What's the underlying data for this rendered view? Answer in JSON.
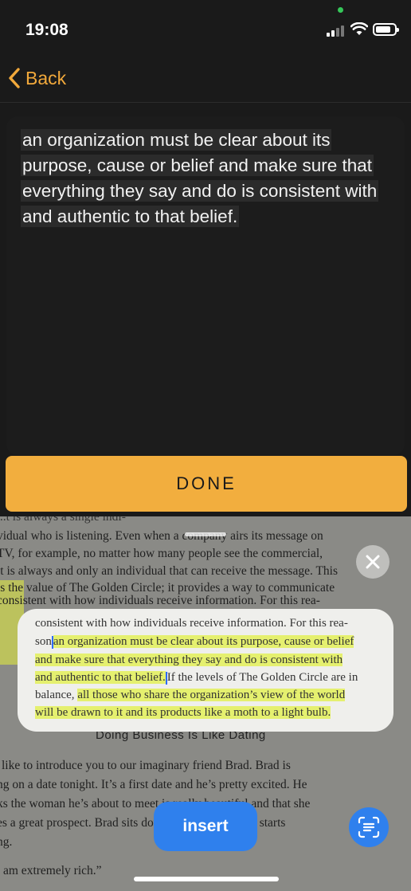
{
  "status_bar": {
    "time": "19:08",
    "icons": [
      "signal-icon",
      "wifi-icon",
      "battery-icon"
    ]
  },
  "nav": {
    "back_label": "Back",
    "accent_color": "#f2a93b"
  },
  "editor": {
    "lines": [
      "an organization must be clear about its",
      "purpose, cause or belief and make sure that",
      "everything they say and do is consistent with",
      "and authentic to that belief."
    ]
  },
  "done_label": "DONE",
  "camera": {
    "book_lines": [
      "vidual who is listening. Even when a company airs its message on",
      "TV, for example, no matter how many people see the commercial,",
      "it is always and only an individual that can receive the message. This",
      "is the value of The Golden Circle; it provides a way to communicate",
      "consistent with how individuals receive information. For this rea-",
      "like to introduce you to our imaginary friend Brad. Brad is",
      "ng on a date tonight. It’s a first date and he’s pretty excited. He",
      "ks the woman he’s about to meet is really beautiful and that she",
      "es a great prospect. Brad sits down for dinner and he starts",
      "ng.",
      "am extremely rich.”"
    ],
    "heading": "Doing Business Is Like Dating"
  },
  "recognized_card": {
    "line1": "consistent with how individuals receive information. For this rea-",
    "line2_pre": "son",
    "line2_hl": "an organization must be clear about its purpose, cause or belief",
    "line3_hl": "and make sure that everything they say and do is consistent with",
    "line4_hl": "and authentic to that belief.",
    "line4_rest": "If the levels of The Golden Circle are in",
    "line5_pre": "balance,",
    "line5_hl": "all those who share the organization’s view of the world",
    "line6_hl": "will be drawn to it and its products like a moth to a light bulb."
  },
  "insert_label": "insert",
  "colors": {
    "done_bg": "#f2ae3e",
    "insert_bg": "#2f80ed",
    "highlight": "#e1f046"
  }
}
